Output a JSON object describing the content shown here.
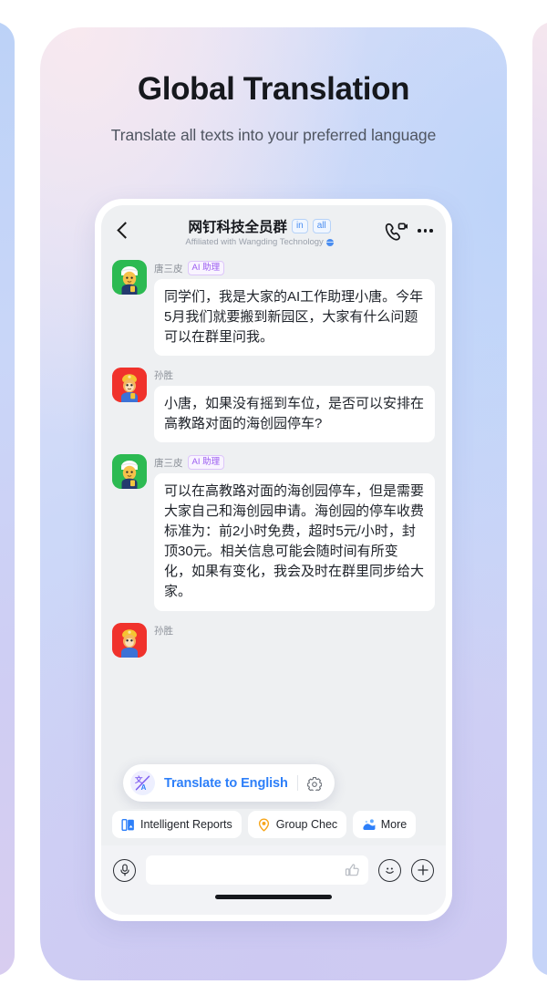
{
  "hero": {
    "title": "Global Translation",
    "subtitle": "Translate all texts into your preferred language"
  },
  "colors": {
    "accent_blue": "#2d7ff9",
    "tag_blue": "#4a8df0",
    "ai_purple": "#9b5cf0",
    "avatar_green": "#2cba52",
    "avatar_red": "#f0322c",
    "chip_orange": "#f7a61b",
    "screen_bg": "#eef0f2"
  },
  "chat_header": {
    "back_icon": "chevron-left-icon",
    "group_title": "网钉科技全员群",
    "tags": [
      "in",
      "all"
    ],
    "subtitle": "Affiliated with Wangding Technology",
    "subtitle_icon": "globe-icon",
    "video_icon": "video-call-icon",
    "more_icon": "more-horizontal-icon"
  },
  "messages": [
    {
      "sender": "唐三皮",
      "badge": "AI 助理",
      "avatar": "ai-assistant-avatar",
      "avatar_color": "green",
      "text": "同学们，我是大家的AI工作助理小唐。今年5月我们就要搬到新园区，大家有什么问题可以在群里问我。"
    },
    {
      "sender": "孙胜",
      "badge": "",
      "avatar": "user-avatar",
      "avatar_color": "red",
      "text": "小唐，如果没有摇到车位，是否可以安排在高教路对面的海创园停车?"
    },
    {
      "sender": "唐三皮",
      "badge": "AI 助理",
      "avatar": "ai-assistant-avatar",
      "avatar_color": "green",
      "text": "可以在高教路对面的海创园停车，但是需要大家自己和海创园申请。海创园的停车收费标准为：前2小时免费，超时5元/小时，封顶30元。相关信息可能会随时间有所变化，如果有变化，我会及时在群里同步给大家。"
    },
    {
      "sender": "孙胜",
      "badge": "",
      "avatar": "user-avatar",
      "avatar_color": "red",
      "text": ""
    }
  ],
  "translate_popup": {
    "icon": "translate-icon",
    "label": "Translate to English",
    "settings_icon": "gear-icon"
  },
  "quick_chips": [
    {
      "label": "Intelligent Reports",
      "icon": "document-report-icon"
    },
    {
      "label": "Group Chec",
      "icon": "location-pin-icon"
    },
    {
      "label": "More",
      "icon": "more-apps-icon"
    }
  ],
  "input_bar": {
    "mic_icon": "microphone-icon",
    "input_value": "",
    "input_placeholder": "",
    "thumb_icon": "thumbs-up-icon",
    "emoji_icon": "emoji-smile-icon",
    "plus_icon": "plus-circle-icon"
  }
}
